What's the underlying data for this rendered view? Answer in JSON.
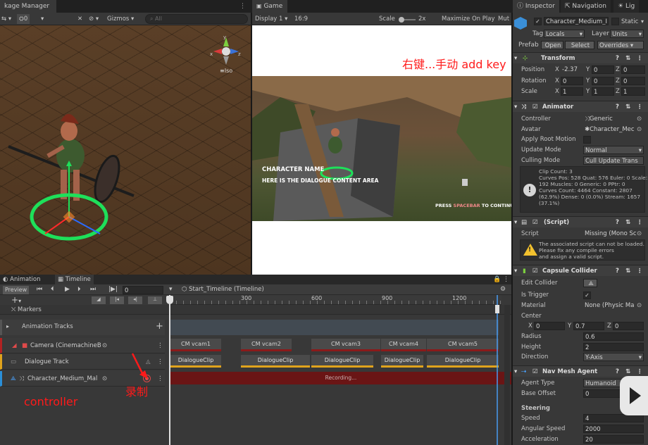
{
  "scene_tabs": {
    "package_manager": "kage Manager"
  },
  "scene_toolbar": {
    "layers": "0",
    "gizmos": "Gizmos",
    "search_placeholder": "All",
    "persp": "Iso"
  },
  "game_tab": "Game",
  "game_toolbar": {
    "display": "Display 1",
    "aspect": "16:9",
    "scale_label": "Scale",
    "scale_value": "2x",
    "maximize": "Maximize On Play",
    "mute": "Mut"
  },
  "game_dialog": {
    "name": "CHARACTER NAME",
    "content": "HERE IS THE DIALOGUE CONTENT AREA",
    "continue_prefix": "PRESS",
    "continue_key": "SPACEBAR",
    "continue_suffix": "TO CONTINUE"
  },
  "annotation_add_key": "右键...手动 add key",
  "annotation_record": "录制",
  "annotation_controller": "controller",
  "inspector": {
    "tabs": [
      "Inspector",
      "Navigation",
      "Lig"
    ],
    "object_name": "Character_Medium_I",
    "static_label": "Static",
    "tag_label": "Tag",
    "tag_value": "Locals",
    "layer_label": "Layer",
    "layer_value": "Units",
    "prefab_label": "Prefab",
    "prefab_open": "Open",
    "prefab_select": "Select",
    "prefab_overrides": "Overrides",
    "transform": {
      "title": "Transform",
      "position": {
        "label": "Position",
        "x": "-2.37",
        "y": "0",
        "z": "0"
      },
      "rotation": {
        "label": "Rotation",
        "x": "0",
        "y": "0",
        "z": "0"
      },
      "scale": {
        "label": "Scale",
        "x": "1",
        "y": "1",
        "z": "1"
      }
    },
    "animator": {
      "title": "Animator",
      "controller_label": "Controller",
      "controller_value": "Generic",
      "avatar_label": "Avatar",
      "avatar_value": "Character_Mec",
      "apply_root_label": "Apply Root Motion",
      "update_mode_label": "Update Mode",
      "update_mode_value": "Normal",
      "culling_label": "Culling Mode",
      "culling_value": "Cull Update Trans",
      "info_lines": [
        "Clip Count: 3",
        "Curves Pos: 528 Quat: 576 Euler: 0 Scale:",
        "192 Muscles: 0 Generic: 0 PPtr: 0",
        "Curves Count: 4464 Constant: 2807",
        "(62.9%) Dense: 0 (0.0%) Stream: 1657",
        "(37.1%)"
      ]
    },
    "script": {
      "title": "(Script)",
      "script_label": "Script",
      "script_value": "Missing (Mono Sc",
      "warning_lines": [
        "The associated script can not be loaded.",
        "Please fix any compile errors",
        "and assign a valid script."
      ]
    },
    "capsule": {
      "title": "Capsule Collider",
      "edit_label": "Edit Collider",
      "trigger_label": "Is Trigger",
      "material_label": "Material",
      "material_value": "None (Physic Ma",
      "center_label": "Center",
      "cx": "0",
      "cy": "0.7",
      "cz": "0",
      "radius_label": "Radius",
      "radius_value": "0.6",
      "height_label": "Height",
      "height_value": "2",
      "direction_label": "Direction",
      "direction_value": "Y-Axis"
    },
    "nav": {
      "title": "Nav Mesh Agent",
      "agent_type_label": "Agent Type",
      "agent_type_value": "Humanoid",
      "base_offset_label": "Base Offset",
      "base_offset_value": "0",
      "steering_label": "Steering",
      "speed_label": "Speed",
      "speed_value": "4",
      "angular_label": "Angular Speed",
      "angular_value": "2000",
      "accel_label": "Acceleration",
      "accel_value": "20"
    }
  },
  "timeline": {
    "tabs": [
      "Animation",
      "Timeline"
    ],
    "preview": "Preview",
    "frame": "0",
    "asset_name": "Start_Timeline (Timeline)",
    "ruler": [
      "300",
      "600",
      "900",
      "1200"
    ],
    "markers": "Markers",
    "animation_tracks": "Animation Tracks",
    "tracks": [
      {
        "name": "Camera (CinemachineB"
      },
      {
        "name": "Dialogue Track"
      },
      {
        "name": "Character_Medium_Mal"
      }
    ],
    "camera_clips": [
      "CM vcam1",
      "CM vcam2",
      "CM vcam3",
      "CM vcam4",
      "CM vcam5"
    ],
    "dialogue_clips": [
      "DialogueClip",
      "DialogueClip",
      "DialogueClip",
      "DialogueClip",
      "DialogueClip"
    ],
    "recording": "Recording..."
  },
  "colors": {
    "accent_red": "#ff1a1a",
    "record_track": "#6a1515",
    "dialogue_yellow": "#e0a31c",
    "camera_red": "#8a1a1a"
  }
}
